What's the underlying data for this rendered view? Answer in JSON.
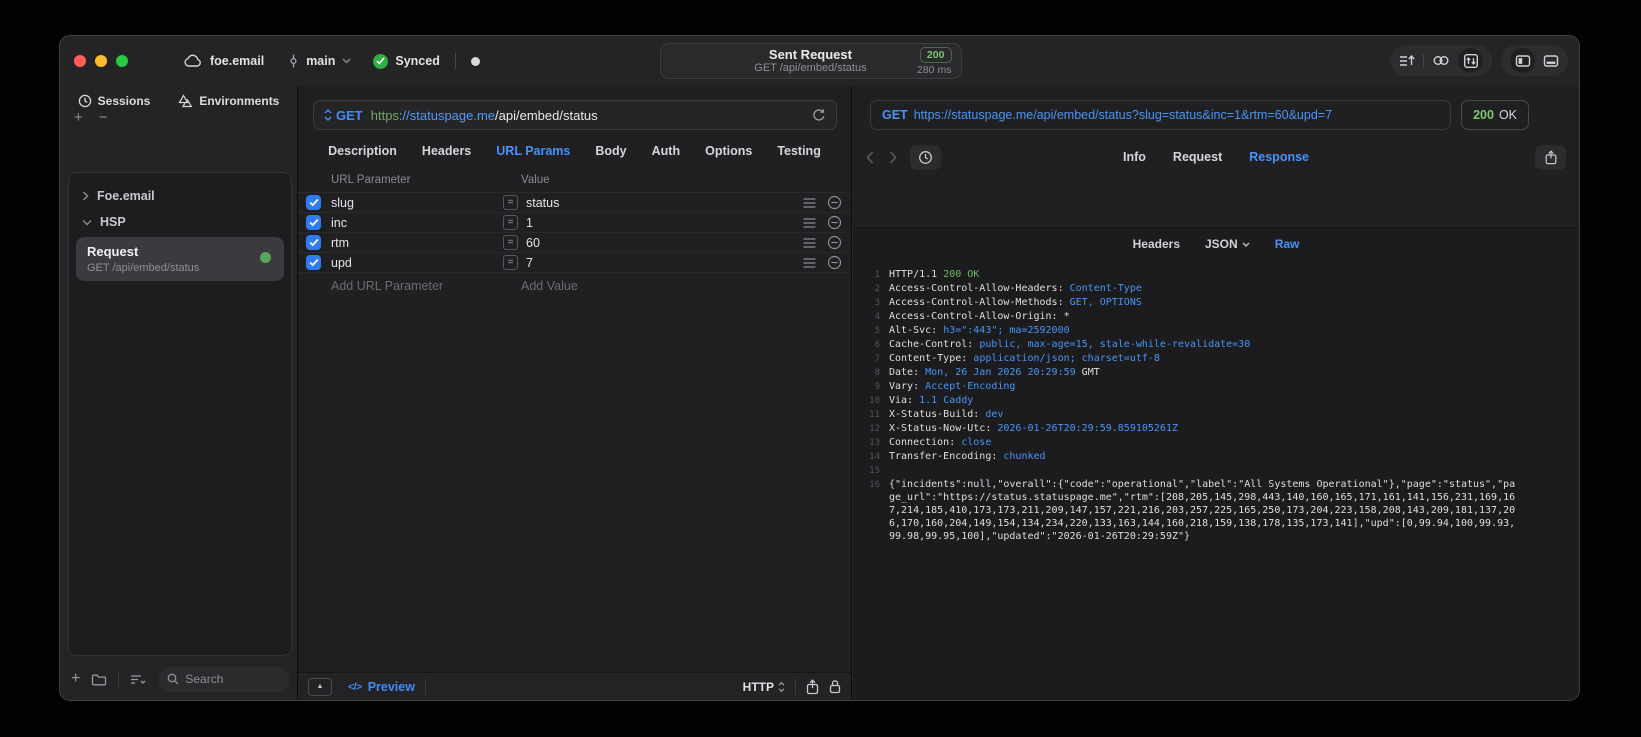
{
  "titlebar": {
    "project": "foe.email",
    "branch": "main",
    "sync_status": "Synced",
    "request_summary": {
      "title": "Sent Request",
      "subtitle": "GET /api/embed/status",
      "status_code": "200",
      "duration": "280 ms"
    }
  },
  "sidebar": {
    "tabs": [
      {
        "label": "Sessions"
      },
      {
        "label": "Environments"
      }
    ],
    "active_tab": "Sessions",
    "groups": [
      {
        "label": "Foe.email"
      },
      {
        "label": "HSP"
      }
    ],
    "request_item": {
      "title": "Request",
      "subtitle": "GET /api/embed/status"
    },
    "search_placeholder": "Search"
  },
  "request_panel": {
    "method": "GET",
    "url": {
      "scheme": "https",
      "host": "://statuspage.me",
      "path": "/api/embed/status"
    },
    "tabs": [
      "Description",
      "Headers",
      "URL Params",
      "Body",
      "Auth",
      "Options",
      "Testing"
    ],
    "active_tab": "URL Params",
    "params": {
      "columns": [
        "URL Parameter",
        "Value"
      ],
      "rows": [
        {
          "name": "slug",
          "value": "status",
          "enabled": "true"
        },
        {
          "name": "inc",
          "value": "1",
          "enabled": "true"
        },
        {
          "name": "rtm",
          "value": "60",
          "enabled": "true"
        },
        {
          "name": "upd",
          "value": "7",
          "enabled": "true"
        }
      ],
      "add_parameter_placeholder": "Add URL Parameter",
      "add_value_placeholder": "Add Value"
    },
    "footer": {
      "preview_label": "Preview",
      "protocol": "HTTP"
    }
  },
  "response_panel": {
    "method": "GET",
    "url": "https://statuspage.me/api/embed/status?slug=status&inc=1&rtm=60&upd=7",
    "status_code": "200",
    "status_text": "OK",
    "tabs": [
      "Info",
      "Request",
      "Response"
    ],
    "active_tab": "Response",
    "subtabs": [
      "Headers",
      "JSON",
      "Raw"
    ],
    "active_subtab": "Raw",
    "lines": [
      {
        "n": "1",
        "segs": [
          [
            "HTTP/1.1 ",
            "k"
          ],
          [
            "200 OK",
            "g"
          ]
        ]
      },
      {
        "n": "2",
        "segs": [
          [
            "Access-Control-Allow-Headers: ",
            "k"
          ],
          [
            "Content-Type",
            "v"
          ]
        ]
      },
      {
        "n": "3",
        "segs": [
          [
            "Access-Control-Allow-Methods: ",
            "k"
          ],
          [
            "GET, OPTIONS",
            "v"
          ]
        ]
      },
      {
        "n": "4",
        "segs": [
          [
            "Access-Control-Allow-Origin: ",
            "k"
          ],
          [
            "*",
            "k"
          ]
        ]
      },
      {
        "n": "5",
        "segs": [
          [
            "Alt-Svc: ",
            "k"
          ],
          [
            "h3=\":443\"; ma=2592000",
            "v"
          ]
        ]
      },
      {
        "n": "6",
        "segs": [
          [
            "Cache-Control: ",
            "k"
          ],
          [
            "public, max-age=15, stale-while-revalidate=30",
            "v"
          ]
        ]
      },
      {
        "n": "7",
        "segs": [
          [
            "Content-Type: ",
            "k"
          ],
          [
            "application/json; charset=utf-8",
            "v"
          ]
        ]
      },
      {
        "n": "8",
        "segs": [
          [
            "Date: ",
            "k"
          ],
          [
            "Mon, 26 Jan 2026 20:29:59 ",
            "v"
          ],
          [
            "GMT",
            "k"
          ]
        ]
      },
      {
        "n": "9",
        "segs": [
          [
            "Vary: ",
            "k"
          ],
          [
            "Accept-Encoding",
            "v"
          ]
        ]
      },
      {
        "n": "10",
        "segs": [
          [
            "Via: ",
            "k"
          ],
          [
            "1.1 Caddy",
            "v"
          ]
        ]
      },
      {
        "n": "11",
        "segs": [
          [
            "X-Status-Build: ",
            "k"
          ],
          [
            "dev",
            "v"
          ]
        ]
      },
      {
        "n": "12",
        "segs": [
          [
            "X-Status-Now-Utc: ",
            "k"
          ],
          [
            "2026-01-26T20:29:59.859105261Z",
            "v"
          ]
        ]
      },
      {
        "n": "13",
        "segs": [
          [
            "Connection: ",
            "k"
          ],
          [
            "close",
            "v"
          ]
        ]
      },
      {
        "n": "14",
        "segs": [
          [
            "Transfer-Encoding: ",
            "k"
          ],
          [
            "chunked",
            "v"
          ]
        ]
      },
      {
        "n": "15",
        "segs": []
      },
      {
        "n": "16",
        "segs": [
          [
            "{\"incidents\":null,\"overall\":{\"code\":\"operational\",\"label\":\"All Systems Operational\"},\"page\":\"status\",\"page_url\":\"https://status.statuspage.me\",\"rtm\":[208,205,145,298,443,140,160,165,171,161,141,156,231,169,167,214,185,410,173,173,211,209,147,157,221,216,203,257,225,165,250,173,204,223,158,208,143,209,181,137,206,170,160,204,149,154,134,234,220,133,163,144,160,218,159,138,178,135,173,141],\"upd\":[0,99.94,100,99.93,99.98,99.95,100],\"updated\":\"2026-01-26T20:29:59Z\"}",
            "k"
          ]
        ]
      }
    ]
  },
  "icons": {
    "equals": "=",
    "collapse": "▲",
    "preview_code": "</>",
    "plus": "+",
    "minus": "−"
  }
}
